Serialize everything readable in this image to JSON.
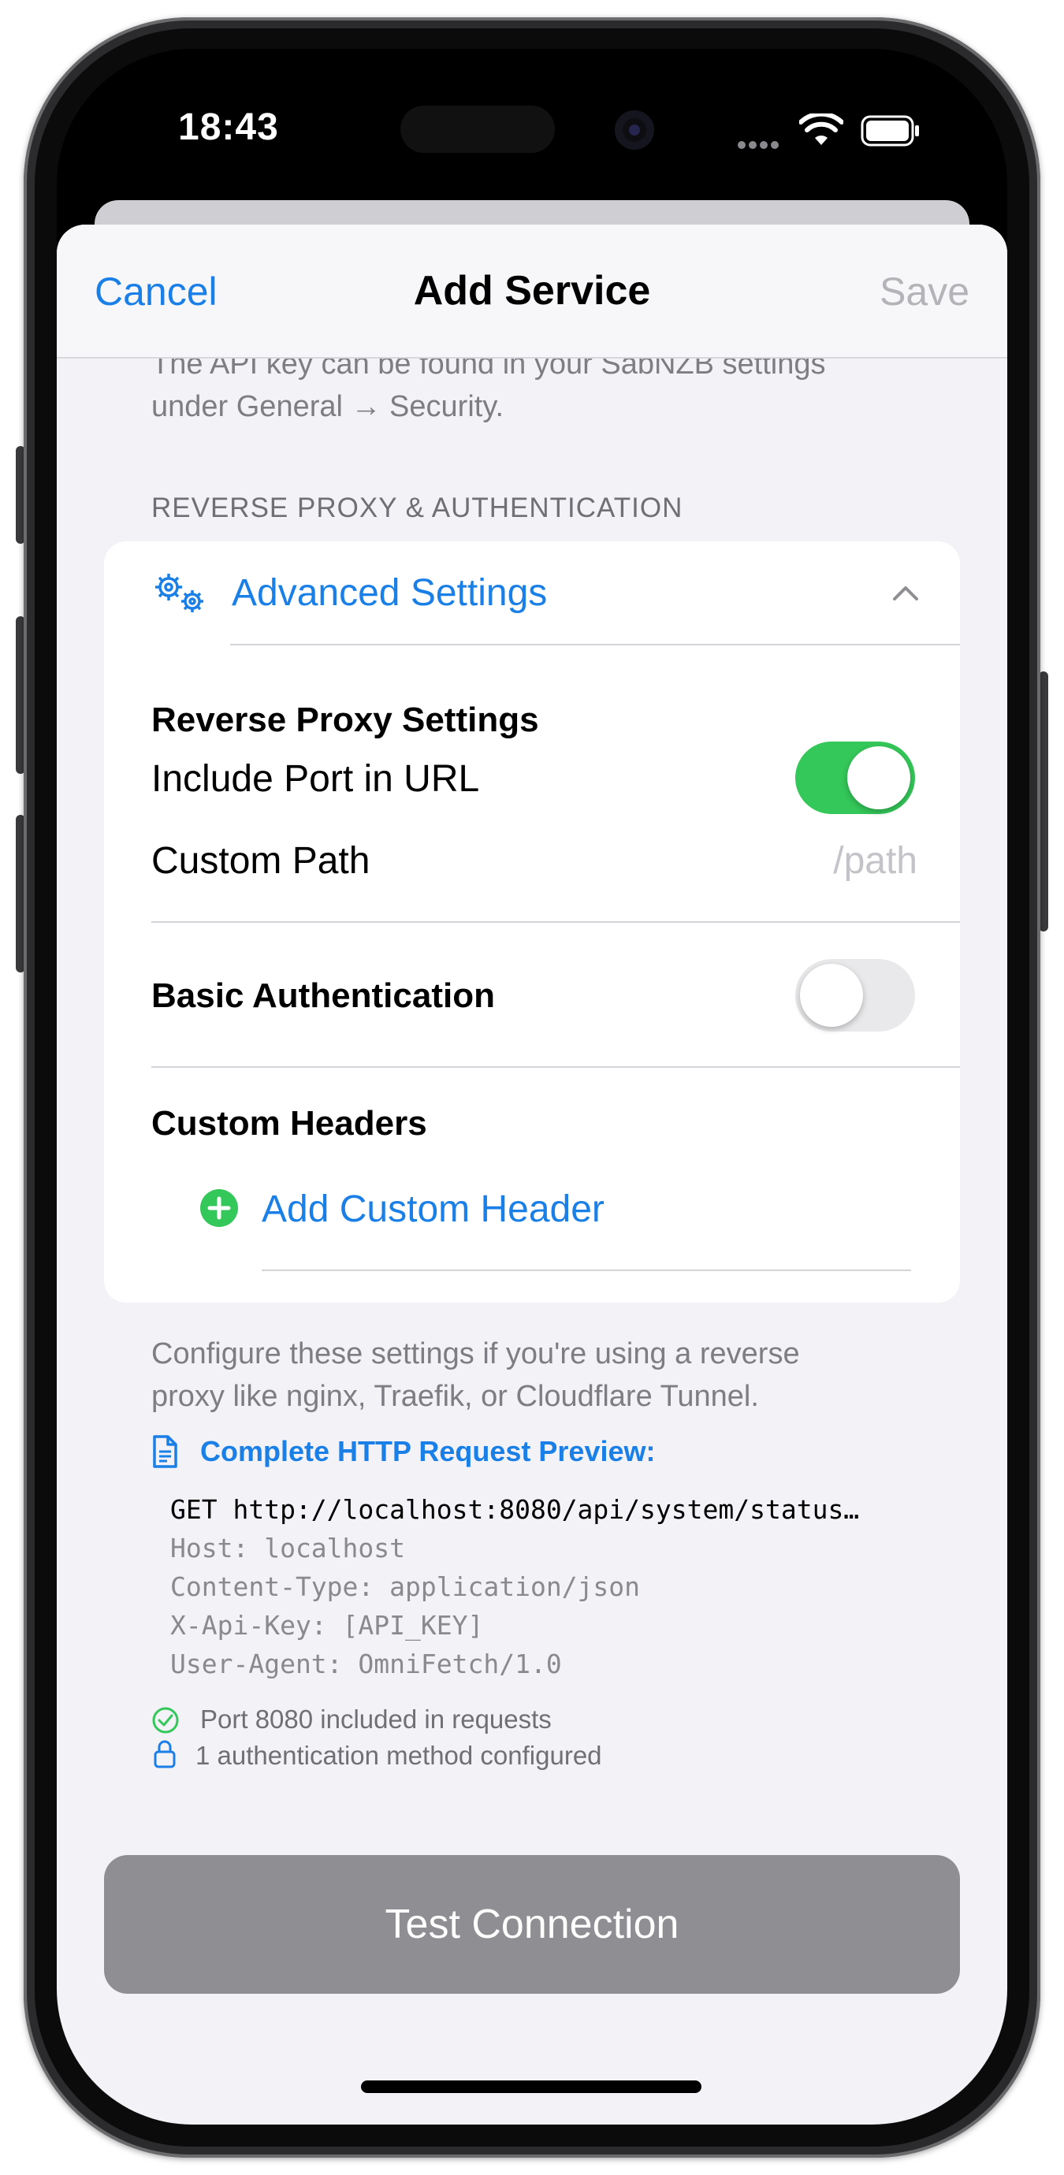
{
  "status_bar": {
    "time": "18:43"
  },
  "nav": {
    "cancel": "Cancel",
    "title": "Add Service",
    "save": "Save"
  },
  "api_note": {
    "line1": "The API key can be found in your SabNZB settings",
    "line2": "under General → Security."
  },
  "section_header": "REVERSE PROXY & AUTHENTICATION",
  "advanced": {
    "label": "Advanced Settings",
    "icon": "gears-icon",
    "expanded": true
  },
  "reverse_proxy": {
    "heading": "Reverse Proxy Settings",
    "include_port_label": "Include Port in URL",
    "include_port_on": true,
    "custom_path_label": "Custom Path",
    "custom_path_placeholder": "/path",
    "custom_path_value": ""
  },
  "basic_auth": {
    "label": "Basic Authentication",
    "on": false
  },
  "custom_headers": {
    "heading": "Custom Headers",
    "add_label": "Add Custom Header"
  },
  "footer_note": {
    "line1": "Configure these settings if you're using a reverse",
    "line2": "proxy like nginx, Traefik, or Cloudflare Tunnel."
  },
  "preview": {
    "title": "Complete HTTP Request Preview:",
    "request_line": "GET http://localhost:8080/api/system/status…",
    "headers": [
      "Host: localhost",
      "Content-Type: application/json",
      "X-Api-Key: [API_KEY]",
      "User-Agent: OmniFetch/1.0"
    ]
  },
  "info": {
    "port_note": "Port 8080 included in requests",
    "auth_note": "1 authentication method configured"
  },
  "test_button": "Test Connection",
  "colors": {
    "accent": "#1a7fe6",
    "toggle_on": "#34c759",
    "background": "#f2f2f7",
    "button_disabled": "#8e8e93"
  }
}
